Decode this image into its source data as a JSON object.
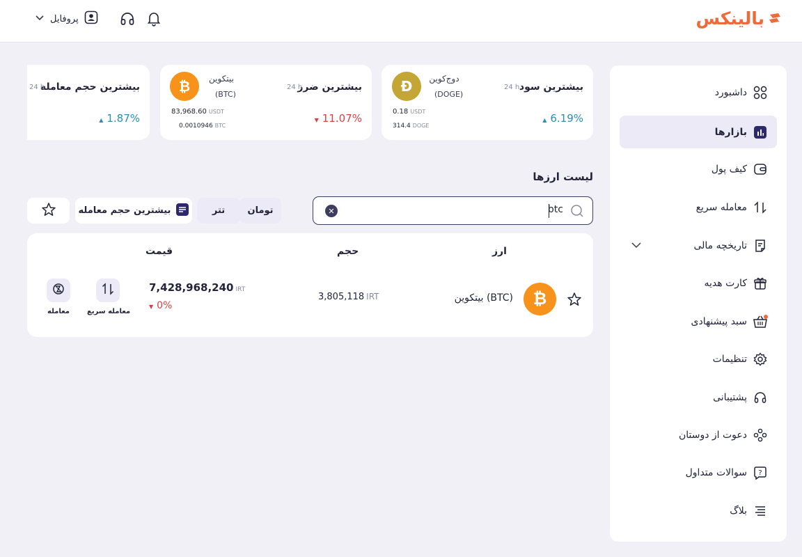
{
  "header": {
    "logo_text": "بالینکس",
    "profile_label": "پروفایل",
    "icons": [
      "bell-icon",
      "headset-icon",
      "user-icon",
      "chevron-down-icon"
    ]
  },
  "sidebar": {
    "items": [
      {
        "label": "داشبورد",
        "icon": "dashboard-icon"
      },
      {
        "label": "بازارها",
        "icon": "chart-icon",
        "active": true
      },
      {
        "label": "کیف پول",
        "icon": "wallet-icon"
      },
      {
        "label": "معامله سریع",
        "icon": "swap-icon"
      },
      {
        "label": "تاریخچه مالی",
        "icon": "receipt-icon",
        "expandable": true
      },
      {
        "label": "کارت هدیه",
        "icon": "gift-icon"
      },
      {
        "label": "سبد پیشنهادی",
        "icon": "basket-icon",
        "badge_dot": true
      },
      {
        "label": "تنظیمات",
        "icon": "gear-icon"
      },
      {
        "label": "پشتیبانی",
        "icon": "headset-icon"
      },
      {
        "label": "دعوت از دوستان",
        "icon": "users-icon"
      },
      {
        "label": "سوالات متداول",
        "icon": "question-icon"
      },
      {
        "label": "بلاگ",
        "icon": "menu-lines-icon"
      }
    ]
  },
  "cards": [
    {
      "title": "بیشترین سود",
      "period": "24 h",
      "coin_name": "دوج‌کوین",
      "coin_symbol": "(DOGE)",
      "coin_letter": "Ð",
      "amount_usdt": "0.18",
      "amount_usdt_unit": "USDT",
      "amount_coin": "314.4",
      "amount_coin_unit": "DOGE",
      "change": "6.19%",
      "direction": "up"
    },
    {
      "title": "بیشترین ضرر",
      "period": "24 h",
      "coin_name": "بیتکوین",
      "coin_symbol": "(BTC)",
      "coin_letter": "₿",
      "amount_usdt": "83,968.60",
      "amount_usdt_unit": "USDT",
      "amount_coin": "0.0010946",
      "amount_coin_unit": "BTC",
      "change": "11.07%",
      "direction": "down"
    },
    {
      "title": "بیشترین حجم معامله",
      "period": "24 h",
      "change": "1.87%",
      "direction": "up"
    }
  ],
  "list": {
    "title": "لیست ارزها",
    "search": {
      "value": "btc"
    },
    "filters": {
      "toman": "تومان",
      "tether": "تتر",
      "sort": "بیشترین حجم معامله"
    },
    "columns": {
      "asset": "ارز",
      "volume": "حجم",
      "price": "قیمت"
    },
    "rows": [
      {
        "name": "بیتکوین (BTC)",
        "coin_letter": "₿",
        "volume": "3,805,118",
        "volume_unit": "IRT",
        "price": "7,428,968,240",
        "price_unit": "IRT",
        "change": "0%",
        "quick_trade_label": "معامله سریع",
        "trade_label": "معامله"
      }
    ]
  },
  "colors": {
    "brand": "#ef6a3a",
    "up": "#2b8fae",
    "down": "#d84142",
    "accent": "#3d3d60",
    "btc": "#f7931a",
    "doge": "#c3a634"
  }
}
